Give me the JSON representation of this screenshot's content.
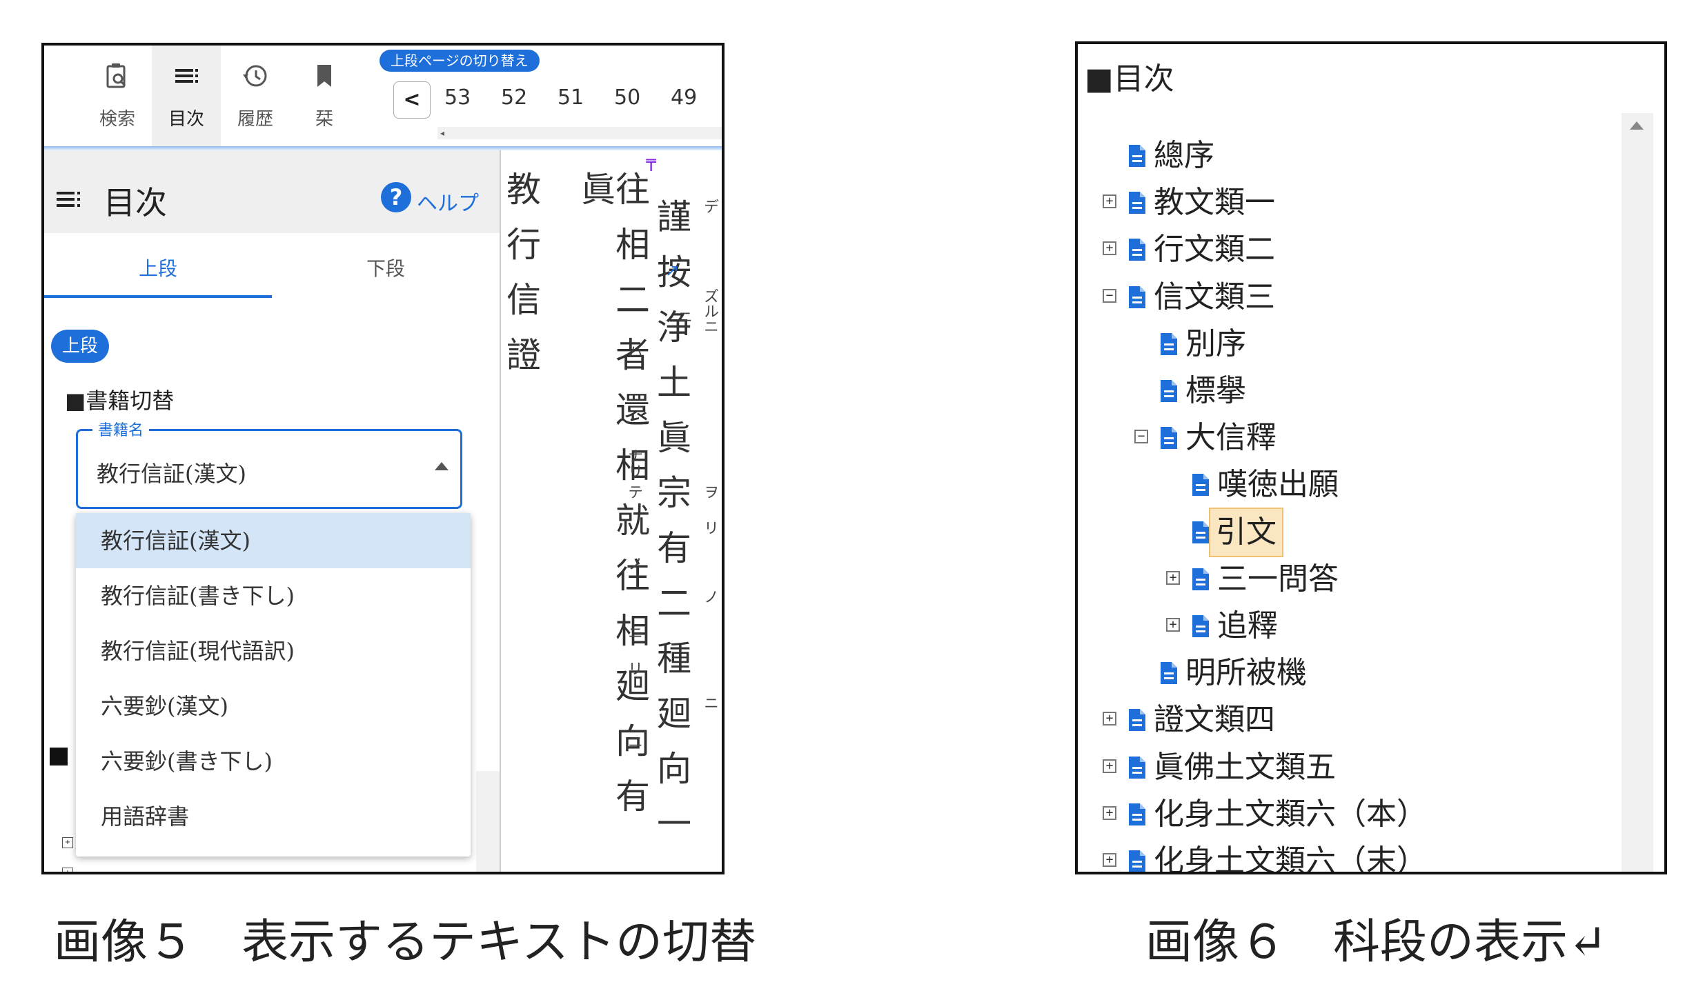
{
  "left_panel": {
    "toolbar": {
      "tools": [
        {
          "label": "検索",
          "icon": "search-clipboard-icon"
        },
        {
          "label": "目次",
          "icon": "list-icon"
        },
        {
          "label": "履歴",
          "icon": "history-icon"
        },
        {
          "label": "栞",
          "icon": "bookmark-icon"
        }
      ],
      "page_switch_label": "上段ページの切り替え",
      "prev_button": "<",
      "page_numbers": [
        "53",
        "52",
        "51",
        "50",
        "49"
      ]
    },
    "toc": {
      "title": "目次",
      "help": "ヘルプ",
      "help_icon_glyph": "?",
      "tabs": [
        "上段",
        "下段"
      ],
      "chip": "上段",
      "book_switch_title": "■書籍切替",
      "select_legend": "書籍名",
      "select_value": "教行信証(漢文)",
      "options": [
        "教行信証(漢文)",
        "教行信証(書き下し)",
        "教行信証(現代語訳)",
        "六要鈔(漢文)",
        "六要鈔(書き下し)",
        "用語辞書"
      ]
    },
    "vertical_text": {
      "col1": "教行信證",
      "col2": "往相二者還相就往相廻向有眞",
      "col3": "謹按浄土眞宗有二種廻向一",
      "ruby": [
        "デ",
        "ズルニ",
        "ニ",
        "ハ",
        "ナリ",
        "テ",
        "ノ",
        "ニ",
        "リ",
        "ヲ",
        "リ",
        "ノ",
        "ニ",
        "ニ"
      ]
    },
    "caption": "画像５　表示するテキストの切替"
  },
  "right_panel": {
    "header": "■目次",
    "tree": [
      {
        "label": "總序",
        "toggle": "",
        "level": 0
      },
      {
        "label": "教文類一",
        "toggle": "+",
        "level": 0
      },
      {
        "label": "行文類二",
        "toggle": "+",
        "level": 0
      },
      {
        "label": "信文類三",
        "toggle": "−",
        "level": 0
      },
      {
        "label": "別序",
        "toggle": "",
        "level": 1
      },
      {
        "label": "標擧",
        "toggle": "",
        "level": 1
      },
      {
        "label": "大信釋",
        "toggle": "−",
        "level": 1
      },
      {
        "label": "嘆徳出願",
        "toggle": "",
        "level": 2
      },
      {
        "label": "引文",
        "toggle": "",
        "level": 2,
        "highlighted": true
      },
      {
        "label": "三一問答",
        "toggle": "+",
        "level": 2
      },
      {
        "label": "追釋",
        "toggle": "+",
        "level": 2
      },
      {
        "label": "明所被機",
        "toggle": "",
        "level": 1
      },
      {
        "label": "證文類四",
        "toggle": "+",
        "level": 0
      },
      {
        "label": "眞佛土文類五",
        "toggle": "+",
        "level": 0
      },
      {
        "label": "化身土文類六（本）",
        "toggle": "+",
        "level": 0
      },
      {
        "label": "化身土文類六（末）",
        "toggle": "+",
        "level": 0
      }
    ],
    "caption": "画像６　科段の表示↵"
  },
  "colors": {
    "accent": "#1e6fd9",
    "highlight": "#fbe6c2",
    "selected_option": "#d4e5f7"
  }
}
